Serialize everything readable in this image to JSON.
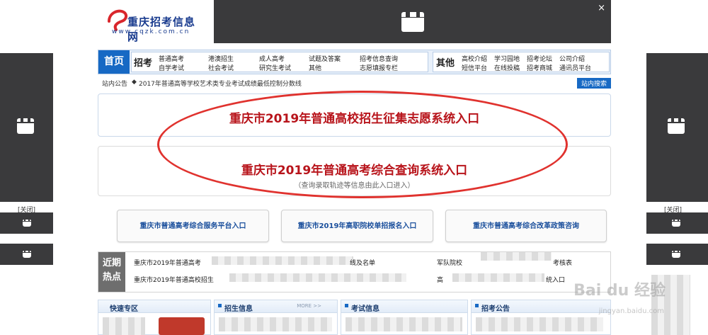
{
  "logo": {
    "name": "重庆招考信息网",
    "url": "www.cqzk.com.cn"
  },
  "ads": {
    "close_label": "×",
    "side_close_label": "[关闭]"
  },
  "nav": {
    "home": "首页",
    "zhaokao_label": "招考",
    "zhaokao_links": [
      "普通高考",
      "港澳招生",
      "成人高考",
      "试题及答案",
      "招考信息查询",
      "自学考试",
      "社会考试",
      "研究生考试",
      "其他",
      "志愿填报专栏"
    ],
    "other_label": "其他",
    "other_links": [
      "高校介绍",
      "学习园地",
      "招考论坛",
      "公司介绍",
      "短信平台",
      "在线投稿",
      "招考商城",
      "通讯员平台"
    ]
  },
  "notice": {
    "label": "站内公告",
    "text": "2017年普通高等学校艺术类专业考试成绩最低控制分数线",
    "search_button": "站内搜索"
  },
  "banners": [
    {
      "title": "重庆市2019年普通高校招生征集志愿系统入口"
    },
    {
      "title": "重庆市2019年普通高考综合查询系统入口",
      "subtitle": "（查询录取轨迹等信息由此入口进入）"
    }
  ],
  "quick_buttons": [
    "重庆市普通高考综合服务平台入口",
    "重庆市2019年高职院校单招报名入口",
    "重庆市普通高考综合改革政策咨询"
  ],
  "hot": {
    "label_line1": "近期",
    "label_line2": "热点",
    "items": [
      "重庆市2019年普通高考",
      "线及名单",
      "军队院校",
      "考核表",
      "重庆市2019年普通高校招生",
      "高",
      "统入口"
    ]
  },
  "sections": {
    "quick_area": "快速专区",
    "admissions": "招生信息",
    "exams": "考试信息",
    "notices": "招考公告",
    "more_label": "MORE >>"
  },
  "watermark": {
    "brand": "Bai du 经验",
    "url": "jingyan.baidu.com"
  }
}
